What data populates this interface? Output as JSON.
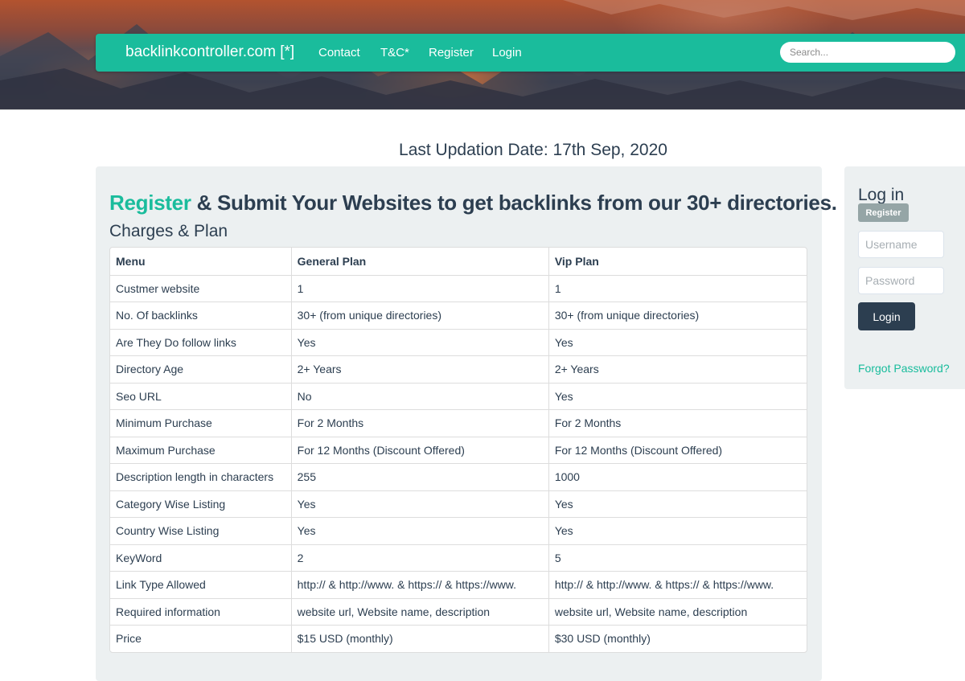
{
  "nav": {
    "brand": "backlinkcontroller.com [*]",
    "links": [
      "Contact",
      "T&C*",
      "Register",
      "Login"
    ],
    "search_placeholder": "Search..."
  },
  "last_updated": "Last Updation Date: 17th Sep, 2020",
  "main": {
    "headline_accent": "Register",
    "headline_rest": " & Submit Your Websites to get backlinks from our 30+ directories.",
    "subheading": "Charges & Plan",
    "table": {
      "headers": [
        "Menu",
        "General Plan",
        "Vip Plan"
      ],
      "rows": [
        [
          "Custmer website",
          "1",
          "1"
        ],
        [
          "No. Of backlinks",
          "30+ (from unique directories)",
          "30+ (from unique directories)"
        ],
        [
          "Are They Do follow links",
          "Yes",
          "Yes"
        ],
        [
          "Directory Age",
          "2+ Years",
          "2+ Years"
        ],
        [
          "Seo URL",
          "No",
          "Yes"
        ],
        [
          "Minimum Purchase",
          "For 2 Months",
          "For 2 Months"
        ],
        [
          "Maximum Purchase",
          "For 12 Months (Discount Offered)",
          "For 12 Months (Discount Offered)"
        ],
        [
          "Description length in characters",
          "255",
          "1000"
        ],
        [
          "Category Wise Listing",
          "Yes",
          "Yes"
        ],
        [
          "Country Wise Listing",
          "Yes",
          "Yes"
        ],
        [
          "KeyWord",
          "2",
          "5"
        ],
        [
          "Link Type Allowed",
          "http:// & http://www. & https:// & https://www.",
          "http:// & http://www. & https:// & https://www."
        ],
        [
          "Required information",
          "website url, Website name, description",
          "website url, Website name, description"
        ],
        [
          "Price",
          "$15 USD (monthly)",
          "$30 USD (monthly)"
        ]
      ]
    }
  },
  "sidebar": {
    "title": "Log in",
    "register_label": "Register",
    "username_placeholder": "Username",
    "password_placeholder": "Password",
    "login_label": "Login",
    "forgot_label": "Forgot Password?"
  },
  "colors": {
    "accent": "#1abc9c",
    "dark": "#2c3e50",
    "panel": "#ecf0f1",
    "muted_button": "#95a5a6"
  }
}
